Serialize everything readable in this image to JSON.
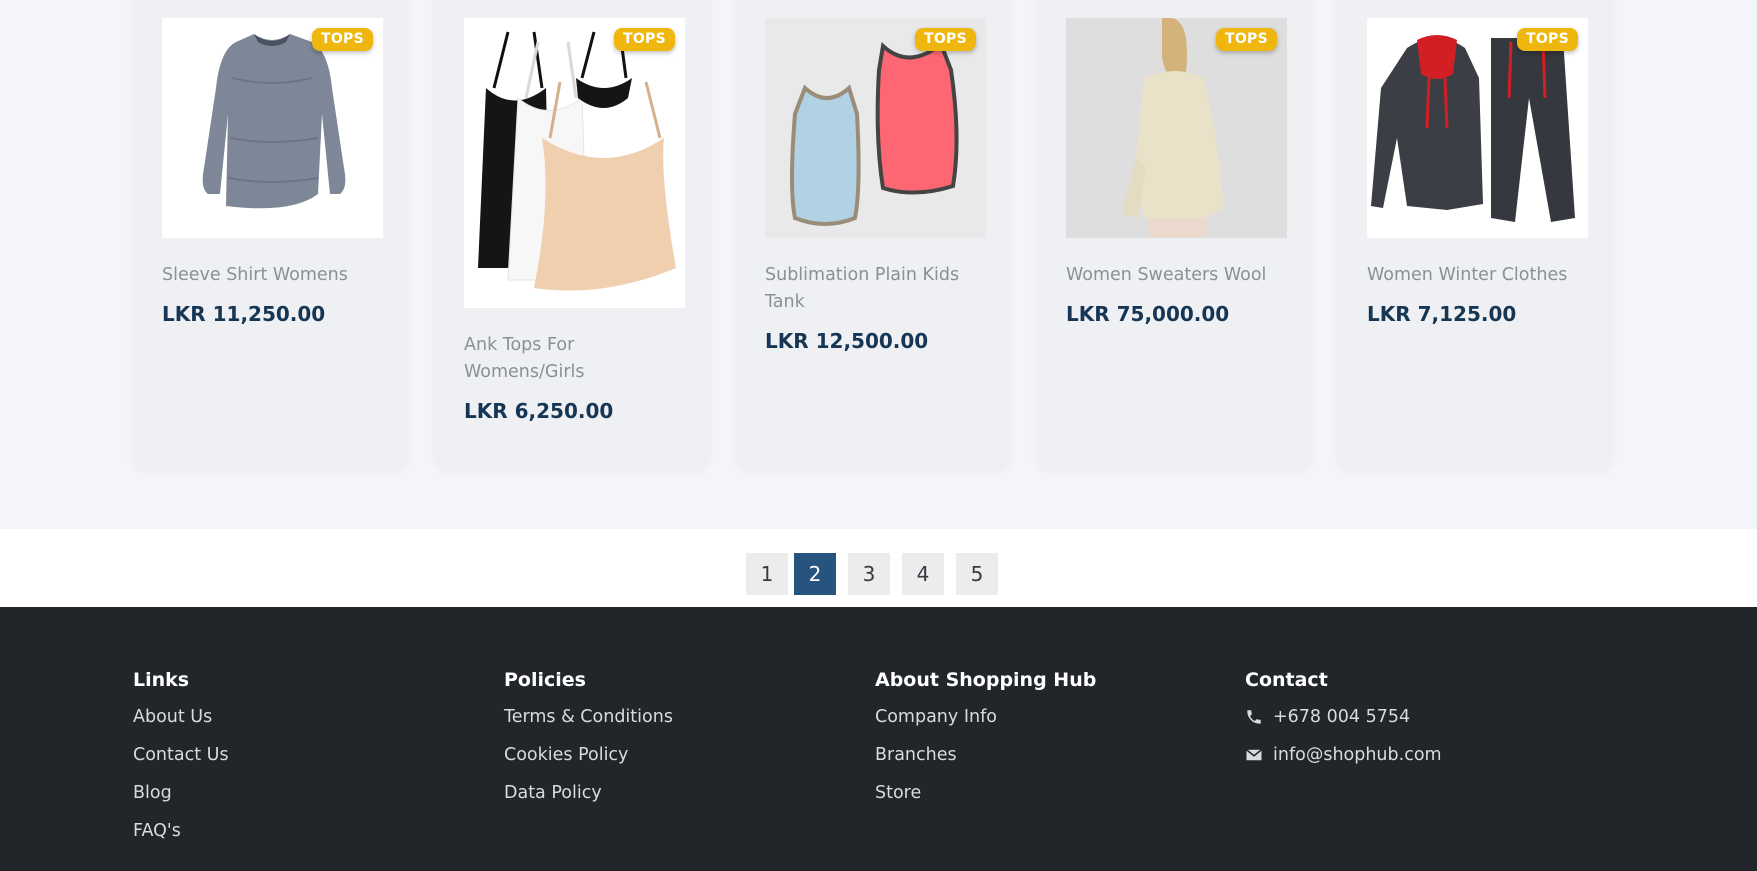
{
  "products": [
    {
      "badge": "TOPS",
      "name": "Sleeve Shirt Womens",
      "price": "LKR 11,250.00",
      "image_icon": "grey-long-sleeve-shirt"
    },
    {
      "badge": "TOPS",
      "name": "Ank Tops For Womens/Girls",
      "price": "LKR 6,250.00",
      "image_icon": "camisole-tank-tops"
    },
    {
      "badge": "TOPS",
      "name": "Sublimation Plain Kids Tank",
      "price": "LKR 12,500.00",
      "image_icon": "kids-tank-tops"
    },
    {
      "badge": "TOPS",
      "name": "Women Sweaters Wool",
      "price": "LKR 75,000.00",
      "image_icon": "woman-wool-sweater"
    },
    {
      "badge": "TOPS",
      "name": "Women Winter Clothes",
      "price": "LKR 7,125.00",
      "image_icon": "hoodie-tracksuit"
    }
  ],
  "pagination": {
    "pages": [
      "1",
      "2",
      "3",
      "4",
      "5"
    ],
    "current": "2"
  },
  "footer": {
    "links": {
      "heading": "Links",
      "items": [
        "About Us",
        "Contact Us",
        "Blog",
        "FAQ's"
      ]
    },
    "policies": {
      "heading": "Policies",
      "items": [
        "Terms & Conditions",
        "Cookies Policy",
        "Data Policy"
      ]
    },
    "about": {
      "heading": "About Shopping Hub",
      "items": [
        "Company Info",
        "Branches",
        "Store"
      ]
    },
    "contact": {
      "heading": "Contact",
      "phone": "+678 004 5754",
      "email": "info@shophub.com"
    }
  },
  "colors": {
    "badge": "#efb60e",
    "price": "#163654",
    "active_page": "#27537f",
    "footer_background": "#222529"
  }
}
